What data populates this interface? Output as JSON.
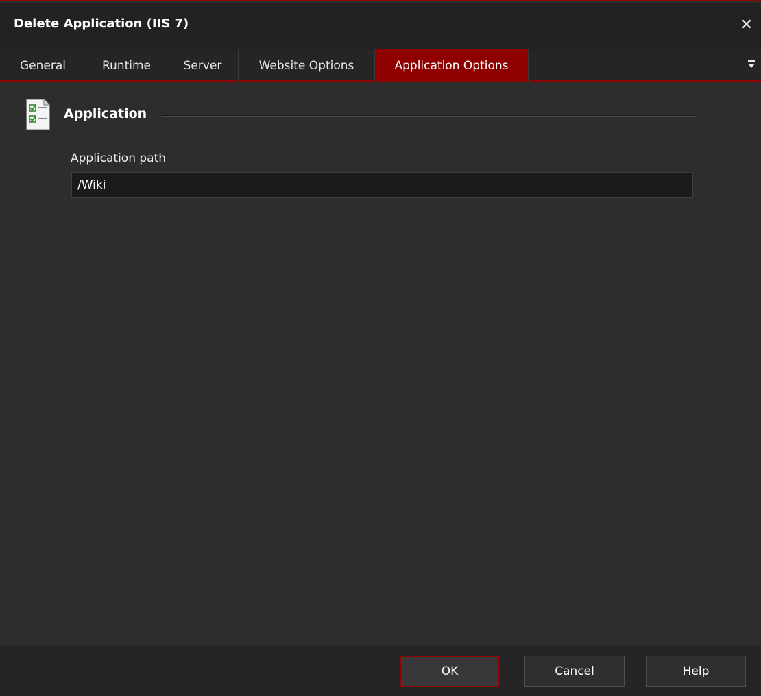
{
  "window": {
    "title": "Delete Application (IIS 7)",
    "close_icon": "close-icon"
  },
  "tabs": [
    {
      "label": "General",
      "active": false
    },
    {
      "label": "Runtime",
      "active": false
    },
    {
      "label": "Server",
      "active": false
    },
    {
      "label": "Website Options",
      "active": false
    },
    {
      "label": "Application Options",
      "active": true
    }
  ],
  "section": {
    "title": "Application",
    "icon": "checklist-document-icon"
  },
  "fields": {
    "application_path": {
      "label": "Application path",
      "value": "/Wiki"
    }
  },
  "buttons": {
    "ok": "OK",
    "cancel": "Cancel",
    "help": "Help"
  },
  "colors": {
    "accent": "#8f0000",
    "background": "#2d2d2e",
    "input_background": "#1b1b1b"
  }
}
